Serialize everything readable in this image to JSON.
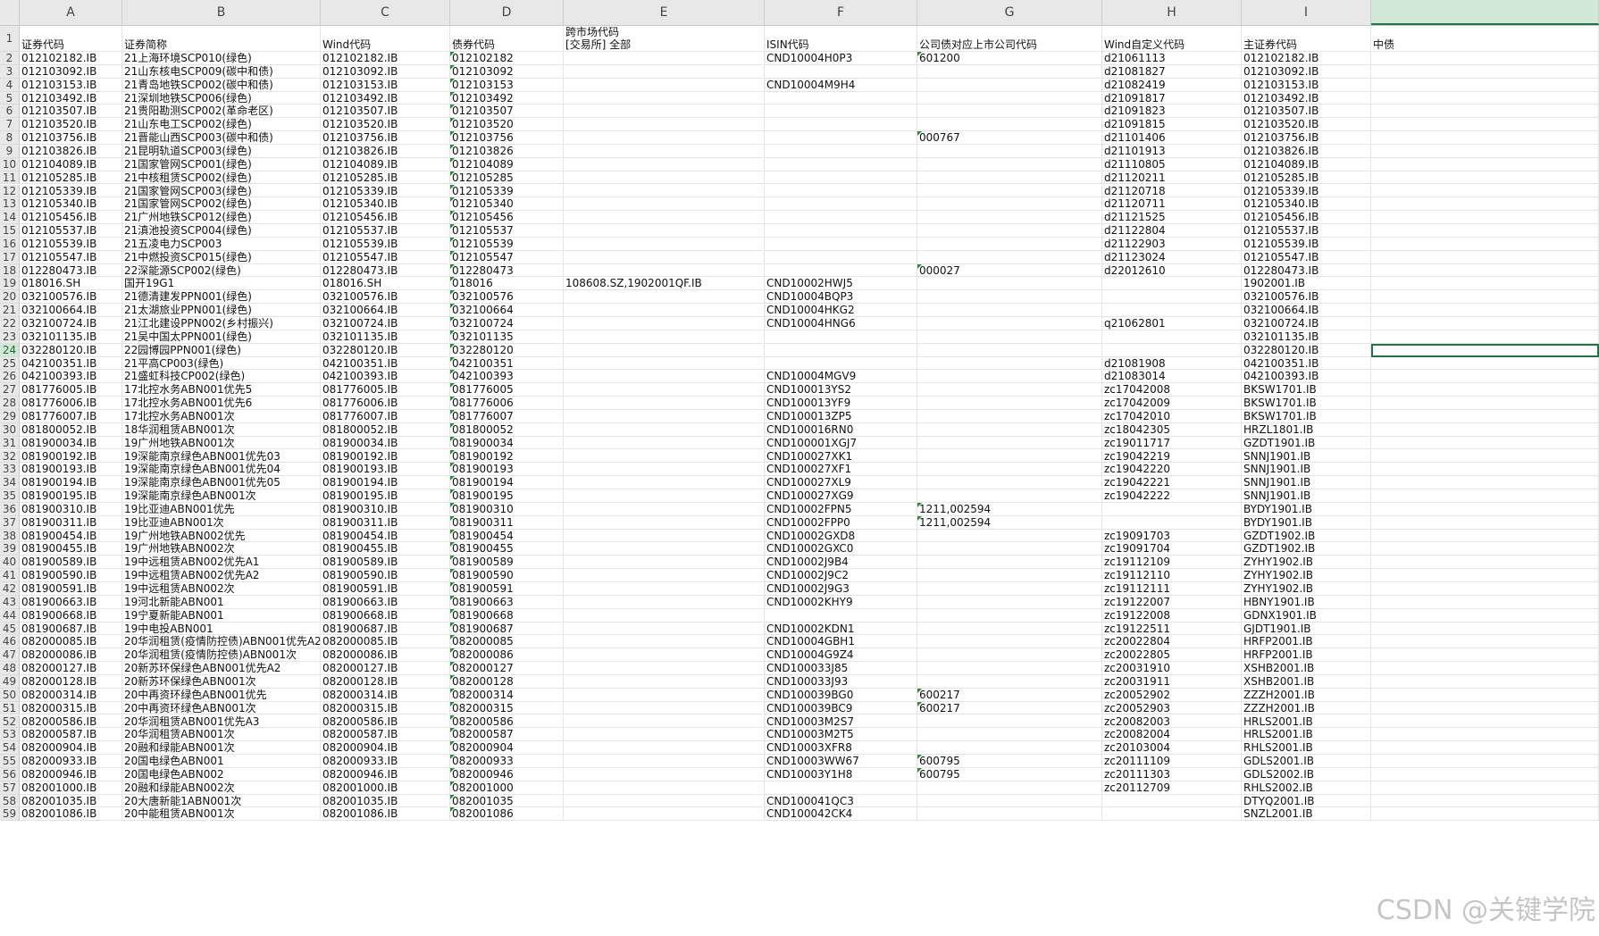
{
  "col_letters": [
    "A",
    "B",
    "C",
    "D",
    "E",
    "F",
    "G",
    "H",
    "I",
    ""
  ],
  "header_row": {
    "row_label": "1",
    "cells": [
      "证券代码",
      "证券简称",
      "Wind代码",
      "债券代码",
      "跨市场代码\n[交易所] 全部",
      "ISIN代码",
      "公司债对应上市公司代码",
      "Wind自定义代码",
      "主证券代码",
      "中债"
    ]
  },
  "rows": [
    {
      "n": "2",
      "c": [
        "012102182.IB",
        "21上海环境SCP010(绿色)",
        "012102182.IB",
        "012102182",
        "",
        "CND10004H0P3",
        "601200",
        "d21061113",
        "012102182.IB"
      ]
    },
    {
      "n": "3",
      "c": [
        "012103092.IB",
        "21山东核电SCP009(碳中和债)",
        "012103092.IB",
        "012103092",
        "",
        "",
        "",
        "d21081827",
        "012103092.IB"
      ]
    },
    {
      "n": "4",
      "c": [
        "012103153.IB",
        "21青岛地铁SCP002(碳中和债)",
        "012103153.IB",
        "012103153",
        "",
        "CND10004M9H4",
        "",
        "d21082419",
        "012103153.IB"
      ]
    },
    {
      "n": "5",
      "c": [
        "012103492.IB",
        "21深圳地铁SCP006(绿色)",
        "012103492.IB",
        "012103492",
        "",
        "",
        "",
        "d21091817",
        "012103492.IB"
      ]
    },
    {
      "n": "6",
      "c": [
        "012103507.IB",
        "21贵阳勘测SCP002(革命老区)",
        "012103507.IB",
        "012103507",
        "",
        "",
        "",
        "d21091823",
        "012103507.IB"
      ]
    },
    {
      "n": "7",
      "c": [
        "012103520.IB",
        "21山东电工SCP002(绿色)",
        "012103520.IB",
        "012103520",
        "",
        "",
        "",
        "d21091815",
        "012103520.IB"
      ]
    },
    {
      "n": "8",
      "c": [
        "012103756.IB",
        "21晋能山西SCP003(碳中和债)",
        "012103756.IB",
        "012103756",
        "",
        "",
        "000767",
        "d21101406",
        "012103756.IB"
      ]
    },
    {
      "n": "9",
      "c": [
        "012103826.IB",
        "21昆明轨道SCP003(绿色)",
        "012103826.IB",
        "012103826",
        "",
        "",
        "",
        "d21101913",
        "012103826.IB"
      ]
    },
    {
      "n": "10",
      "c": [
        "012104089.IB",
        "21国家管网SCP001(绿色)",
        "012104089.IB",
        "012104089",
        "",
        "",
        "",
        "d21110805",
        "012104089.IB"
      ]
    },
    {
      "n": "11",
      "c": [
        "012105285.IB",
        "21中核租赁SCP002(绿色)",
        "012105285.IB",
        "012105285",
        "",
        "",
        "",
        "d21120211",
        "012105285.IB"
      ]
    },
    {
      "n": "12",
      "c": [
        "012105339.IB",
        "21国家管网SCP003(绿色)",
        "012105339.IB",
        "012105339",
        "",
        "",
        "",
        "d21120718",
        "012105339.IB"
      ]
    },
    {
      "n": "13",
      "c": [
        "012105340.IB",
        "21国家管网SCP002(绿色)",
        "012105340.IB",
        "012105340",
        "",
        "",
        "",
        "d21120711",
        "012105340.IB"
      ]
    },
    {
      "n": "14",
      "c": [
        "012105456.IB",
        "21广州地铁SCP012(绿色)",
        "012105456.IB",
        "012105456",
        "",
        "",
        "",
        "d21121525",
        "012105456.IB"
      ]
    },
    {
      "n": "15",
      "c": [
        "012105537.IB",
        "21滇池投资SCP004(绿色)",
        "012105537.IB",
        "012105537",
        "",
        "",
        "",
        "d21122804",
        "012105537.IB"
      ]
    },
    {
      "n": "16",
      "c": [
        "012105539.IB",
        "21五凌电力SCP003",
        "012105539.IB",
        "012105539",
        "",
        "",
        "",
        "d21122903",
        "012105539.IB"
      ]
    },
    {
      "n": "17",
      "c": [
        "012105547.IB",
        "21中燃投资SCP015(绿色)",
        "012105547.IB",
        "012105547",
        "",
        "",
        "",
        "d21123024",
        "012105547.IB"
      ]
    },
    {
      "n": "18",
      "c": [
        "012280473.IB",
        "22深能源SCP002(绿色)",
        "012280473.IB",
        "012280473",
        "",
        "",
        "000027",
        "d22012610",
        "012280473.IB"
      ]
    },
    {
      "n": "19",
      "c": [
        "018016.SH",
        "国开19G1",
        "018016.SH",
        "018016",
        "108608.SZ,1902001QF.IB",
        "CND10002HWJ5",
        "",
        "",
        "1902001.IB"
      ]
    },
    {
      "n": "20",
      "c": [
        "032100576.IB",
        "21德清建发PPN001(绿色)",
        "032100576.IB",
        "032100576",
        "",
        "CND10004BQP3",
        "",
        "",
        "032100576.IB"
      ]
    },
    {
      "n": "21",
      "c": [
        "032100664.IB",
        "21太湖旅业PPN001(绿色)",
        "032100664.IB",
        "032100664",
        "",
        "CND10004HKG2",
        "",
        "",
        "032100664.IB"
      ]
    },
    {
      "n": "22",
      "c": [
        "032100724.IB",
        "21江北建设PPN002(乡村振兴)",
        "032100724.IB",
        "032100724",
        "",
        "CND10004HNG6",
        "",
        "q21062801",
        "032100724.IB"
      ]
    },
    {
      "n": "23",
      "c": [
        "032101135.IB",
        "21吴中国太PPN001(绿色)",
        "032101135.IB",
        "032101135",
        "",
        "",
        "",
        "",
        "032101135.IB"
      ]
    },
    {
      "n": "24",
      "c": [
        "032280120.IB",
        "22园博园PPN001(绿色)",
        "032280120.IB",
        "032280120",
        "",
        "",
        "",
        "",
        "032280120.IB"
      ]
    },
    {
      "n": "25",
      "c": [
        "042100351.IB",
        "21平高CP003(绿色)",
        "042100351.IB",
        "042100351",
        "",
        "",
        "",
        "d21081908",
        "042100351.IB"
      ]
    },
    {
      "n": "26",
      "c": [
        "042100393.IB",
        "21盛虹科技CP002(绿色)",
        "042100393.IB",
        "042100393",
        "",
        "CND10004MGV9",
        "",
        "d21083014",
        "042100393.IB"
      ]
    },
    {
      "n": "27",
      "c": [
        "081776005.IB",
        "17北控水务ABN001优先5",
        "081776005.IB",
        "081776005",
        "",
        "CND100013YS2",
        "",
        "zc17042008",
        "BKSW1701.IB"
      ]
    },
    {
      "n": "28",
      "c": [
        "081776006.IB",
        "17北控水务ABN001优先6",
        "081776006.IB",
        "081776006",
        "",
        "CND100013YF9",
        "",
        "zc17042009",
        "BKSW1701.IB"
      ]
    },
    {
      "n": "29",
      "c": [
        "081776007.IB",
        "17北控水务ABN001次",
        "081776007.IB",
        "081776007",
        "",
        "CND100013ZP5",
        "",
        "zc17042010",
        "BKSW1701.IB"
      ]
    },
    {
      "n": "30",
      "c": [
        "081800052.IB",
        "18华润租赁ABN001次",
        "081800052.IB",
        "081800052",
        "",
        "CND100016RN0",
        "",
        "zc18042305",
        "HRZL1801.IB"
      ]
    },
    {
      "n": "31",
      "c": [
        "081900034.IB",
        "19广州地铁ABN001次",
        "081900034.IB",
        "081900034",
        "",
        "CND100001XGJ7",
        "",
        "zc19011717",
        "GZDT1901.IB"
      ]
    },
    {
      "n": "32",
      "c": [
        "081900192.IB",
        "19深能南京绿色ABN001优先03",
        "081900192.IB",
        "081900192",
        "",
        "CND100027XK1",
        "",
        "zc19042219",
        "SNNJ1901.IB"
      ]
    },
    {
      "n": "33",
      "c": [
        "081900193.IB",
        "19深能南京绿色ABN001优先04",
        "081900193.IB",
        "081900193",
        "",
        "CND100027XF1",
        "",
        "zc19042220",
        "SNNJ1901.IB"
      ]
    },
    {
      "n": "34",
      "c": [
        "081900194.IB",
        "19深能南京绿色ABN001优先05",
        "081900194.IB",
        "081900194",
        "",
        "CND100027XL9",
        "",
        "zc19042221",
        "SNNJ1901.IB"
      ]
    },
    {
      "n": "35",
      "c": [
        "081900195.IB",
        "19深能南京绿色ABN001次",
        "081900195.IB",
        "081900195",
        "",
        "CND100027XG9",
        "",
        "zc19042222",
        "SNNJ1901.IB"
      ]
    },
    {
      "n": "36",
      "c": [
        "081900310.IB",
        "19比亚迪ABN001优先",
        "081900310.IB",
        "081900310",
        "",
        "CND10002FPN5",
        "1211,002594",
        "",
        "BYDY1901.IB"
      ]
    },
    {
      "n": "37",
      "c": [
        "081900311.IB",
        "19比亚迪ABN001次",
        "081900311.IB",
        "081900311",
        "",
        "CND10002FPP0",
        "1211,002594",
        "",
        "BYDY1901.IB"
      ]
    },
    {
      "n": "38",
      "c": [
        "081900454.IB",
        "19广州地铁ABN002优先",
        "081900454.IB",
        "081900454",
        "",
        "CND10002GXD8",
        "",
        "zc19091703",
        "GZDT1902.IB"
      ]
    },
    {
      "n": "39",
      "c": [
        "081900455.IB",
        "19广州地铁ABN002次",
        "081900455.IB",
        "081900455",
        "",
        "CND10002GXC0",
        "",
        "zc19091704",
        "GZDT1902.IB"
      ]
    },
    {
      "n": "40",
      "c": [
        "081900589.IB",
        "19中远租赁ABN002优先A1",
        "081900589.IB",
        "081900589",
        "",
        "CND10002J9B4",
        "",
        "zc19112109",
        "ZYHY1902.IB"
      ]
    },
    {
      "n": "41",
      "c": [
        "081900590.IB",
        "19中远租赁ABN002优先A2",
        "081900590.IB",
        "081900590",
        "",
        "CND10002J9C2",
        "",
        "zc19112110",
        "ZYHY1902.IB"
      ]
    },
    {
      "n": "42",
      "c": [
        "081900591.IB",
        "19中远租赁ABN002次",
        "081900591.IB",
        "081900591",
        "",
        "CND10002J9G3",
        "",
        "zc19112111",
        "ZYHY1902.IB"
      ]
    },
    {
      "n": "43",
      "c": [
        "081900663.IB",
        "19河北新能ABN001",
        "081900663.IB",
        "081900663",
        "",
        "CND10002KHY9",
        "",
        "zc19122007",
        "HBNY1901.IB"
      ]
    },
    {
      "n": "44",
      "c": [
        "081900668.IB",
        "19宁夏新能ABN001",
        "081900668.IB",
        "081900668",
        "",
        "",
        "",
        "zc19122008",
        "GDNX1901.IB"
      ]
    },
    {
      "n": "45",
      "c": [
        "081900687.IB",
        "19中电投ABN001",
        "081900687.IB",
        "081900687",
        "",
        "CND10002KDN1",
        "",
        "zc19122511",
        "GJDT1901.IB"
      ]
    },
    {
      "n": "46",
      "c": [
        "082000085.IB",
        "20华润租赁(疫情防控债)ABN001优先A2",
        "082000085.IB",
        "082000085",
        "",
        "CND10004GBH1",
        "",
        "zc20022804",
        "HRFP2001.IB"
      ]
    },
    {
      "n": "47",
      "c": [
        "082000086.IB",
        "20华润租赁(疫情防控债)ABN001次",
        "082000086.IB",
        "082000086",
        "",
        "CND10004G9Z4",
        "",
        "zc20022805",
        "HRFP2001.IB"
      ]
    },
    {
      "n": "48",
      "c": [
        "082000127.IB",
        "20新苏环保绿色ABN001优先A2",
        "082000127.IB",
        "082000127",
        "",
        "CND100033J85",
        "",
        "zc20031910",
        "XSHB2001.IB"
      ]
    },
    {
      "n": "49",
      "c": [
        "082000128.IB",
        "20新苏环保绿色ABN001次",
        "082000128.IB",
        "082000128",
        "",
        "CND100033J93",
        "",
        "zc20031911",
        "XSHB2001.IB"
      ]
    },
    {
      "n": "50",
      "c": [
        "082000314.IB",
        "20中再资环绿色ABN001优先",
        "082000314.IB",
        "082000314",
        "",
        "CND100039BG0",
        "600217",
        "zc20052902",
        "ZZZH2001.IB"
      ]
    },
    {
      "n": "51",
      "c": [
        "082000315.IB",
        "20中再资环绿色ABN001次",
        "082000315.IB",
        "082000315",
        "",
        "CND100039BC9",
        "600217",
        "zc20052903",
        "ZZZH2001.IB"
      ]
    },
    {
      "n": "52",
      "c": [
        "082000586.IB",
        "20华润租赁ABN001优先A3",
        "082000586.IB",
        "082000586",
        "",
        "CND10003M2S7",
        "",
        "zc20082003",
        "HRLS2001.IB"
      ]
    },
    {
      "n": "53",
      "c": [
        "082000587.IB",
        "20华润租赁ABN001次",
        "082000587.IB",
        "082000587",
        "",
        "CND10003M2T5",
        "",
        "zc20082004",
        "HRLS2001.IB"
      ]
    },
    {
      "n": "54",
      "c": [
        "082000904.IB",
        "20融和绿能ABN001次",
        "082000904.IB",
        "082000904",
        "",
        "CND10003XFR8",
        "",
        "zc20103004",
        "RHLS2001.IB"
      ]
    },
    {
      "n": "55",
      "c": [
        "082000933.IB",
        "20国电绿色ABN001",
        "082000933.IB",
        "082000933",
        "",
        "CND10003WW67",
        "600795",
        "zc20111109",
        "GDLS2001.IB"
      ]
    },
    {
      "n": "56",
      "c": [
        "082000946.IB",
        "20国电绿色ABN002",
        "082000946.IB",
        "082000946",
        "",
        "CND10003Y1H8",
        "600795",
        "zc20111303",
        "GDLS2002.IB"
      ]
    },
    {
      "n": "57",
      "c": [
        "082001000.IB",
        "20融和绿能ABN002次",
        "082001000.IB",
        "082001000",
        "",
        "",
        "",
        "zc20112709",
        "RHLS2002.IB"
      ]
    },
    {
      "n": "58",
      "c": [
        "082001035.IB",
        "20大唐新能1ABN001次",
        "082001035.IB",
        "082001035",
        "",
        "CND100041QC3",
        "",
        "",
        "DTYQ2001.IB"
      ]
    },
    {
      "n": "59",
      "c": [
        "082001086.IB",
        "20中能租赁ABN001次",
        "082001086.IB",
        "082001086",
        "",
        "CND100042CK4",
        "",
        "",
        "SNZL2001.IB"
      ]
    }
  ],
  "selection": {
    "row": "24",
    "col": "J"
  },
  "watermark": "CSDN @关键学院",
  "colors": {
    "accent": "#217346",
    "header_bg": "#e8e8e8",
    "text_marker": "#2e8b3e"
  }
}
